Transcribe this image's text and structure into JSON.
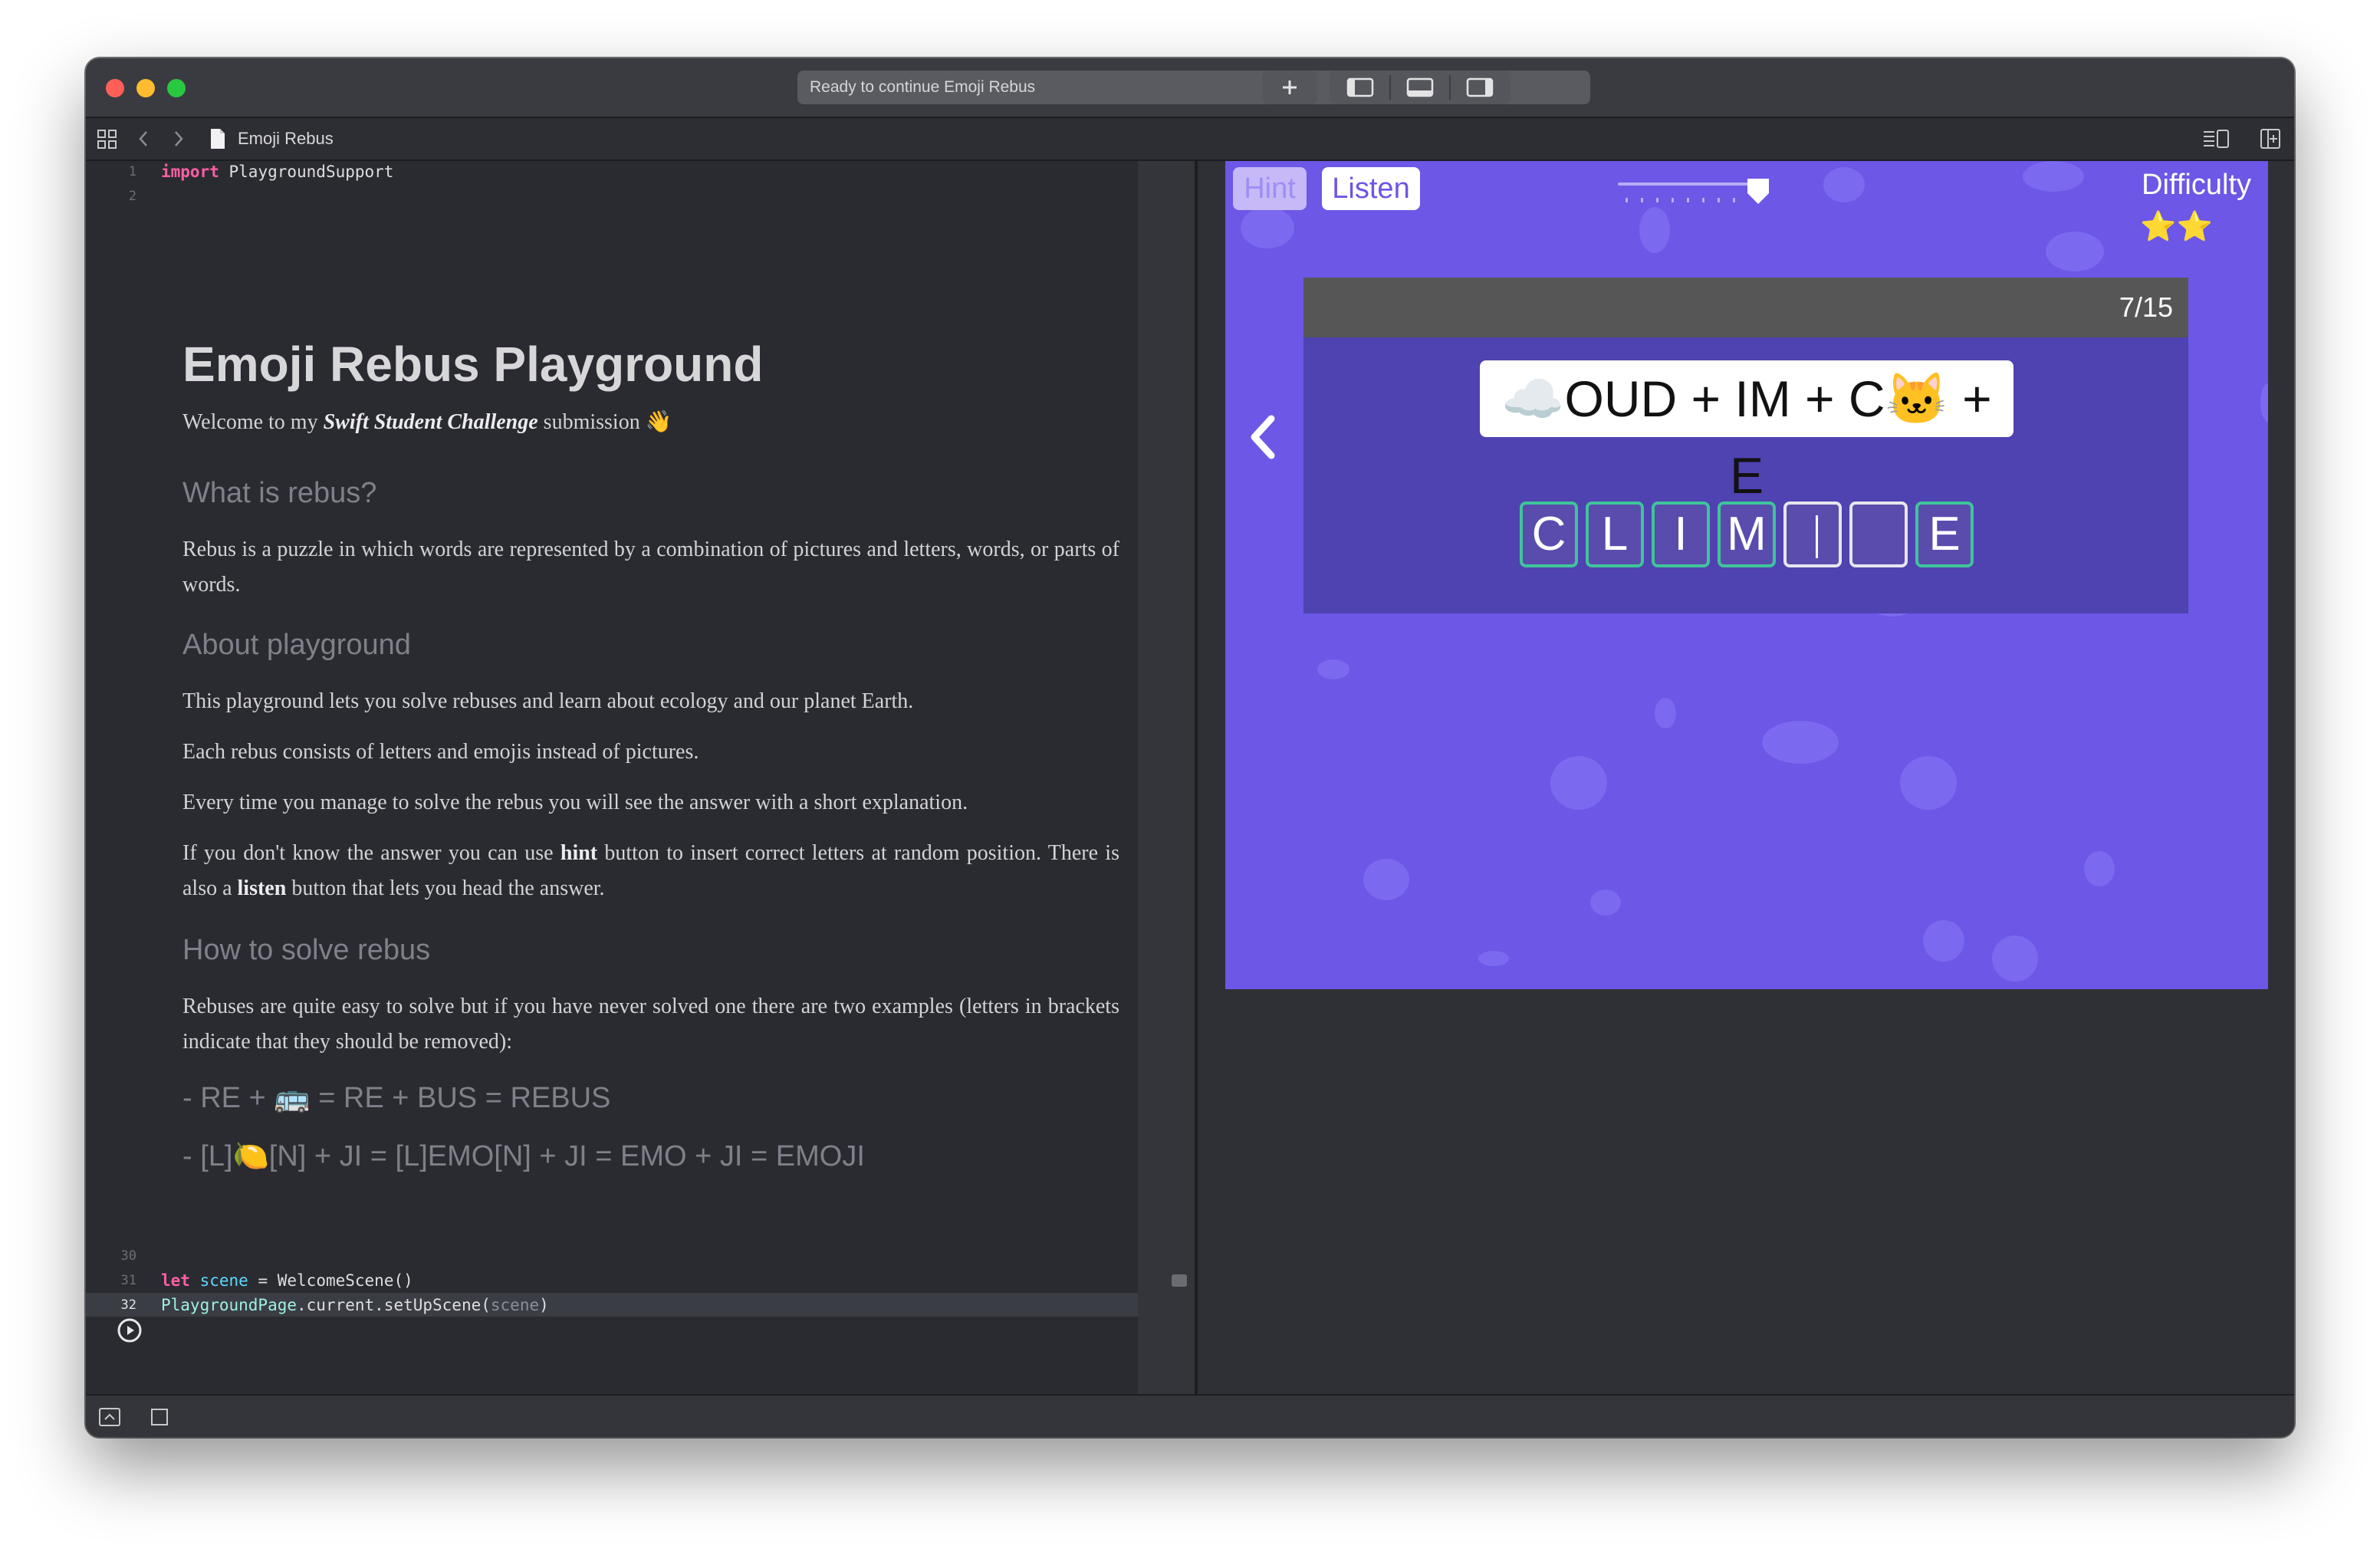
{
  "window": {
    "activity_text": "Ready to continue Emoji Rebus",
    "breadcrumb": {
      "file": "Emoji Rebus"
    }
  },
  "editor": {
    "lines": [
      {
        "num": "1",
        "text": "import PlaygroundSupport"
      },
      {
        "num": "2",
        "text": ""
      },
      {
        "num": "30",
        "text": ""
      },
      {
        "num": "31",
        "text": "let scene = WelcomeScene()"
      },
      {
        "num": "32",
        "text": "PlaygroundPage.current.setUpScene(scene)"
      }
    ],
    "doc": {
      "title": "Emoji Rebus Playground",
      "welcome": {
        "prefix": "Welcome to my ",
        "emphasis": "Swift Student Challenge",
        "suffix": " submission 👋"
      },
      "h_what": "What is rebus?",
      "p_what": "Rebus is a puzzle in which words are represented by a combination of pictures and letters, words, or parts of words.",
      "h_about": "About playground",
      "p_about1": "This playground lets you solve rebuses and learn about ecology and our planet Earth.",
      "p_about2": "Each rebus consists of letters and emojis instead of pictures.",
      "p_about3": "Every time you manage to solve the rebus you will see the answer with a short explanation.",
      "p_hint": {
        "a": "If you don't know the answer you can use ",
        "hint": "hint",
        "b": " button to insert correct letters at random position. There is also a ",
        "listen": "listen",
        "c": " button that lets you head the answer."
      },
      "h_how": "How to solve rebus",
      "p_how": "Rebuses are quite easy to solve but if you have never solved one there are two examples (letters in brackets indicate that they should be removed):",
      "example1": "- RE + 🚌 = RE + BUS = REBUS",
      "example2": "- [L]🍋[N] + JI = [L]EMO[N] + JI = EMO + JI = EMOJI"
    }
  },
  "game": {
    "hint_label": "Hint",
    "listen_label": "Listen",
    "difficulty_label": "Difficulty",
    "difficulty_stars": "⭐⭐",
    "progress": "7/15",
    "back_symbol": "‹",
    "puzzle": {
      "cloud": "☁️",
      "text1": "OUD + IM + C",
      "cat": "🐱",
      "text2": " + E"
    },
    "answer_tiles": [
      "C",
      "L",
      "I",
      "M",
      "",
      "",
      "E"
    ],
    "slider_level": 0.97
  },
  "colors": {
    "scene_bg": "#6c57e6",
    "card_bg": "#4f42b1",
    "tile_border": "#3fc49a",
    "accent": "#ff5f57"
  }
}
